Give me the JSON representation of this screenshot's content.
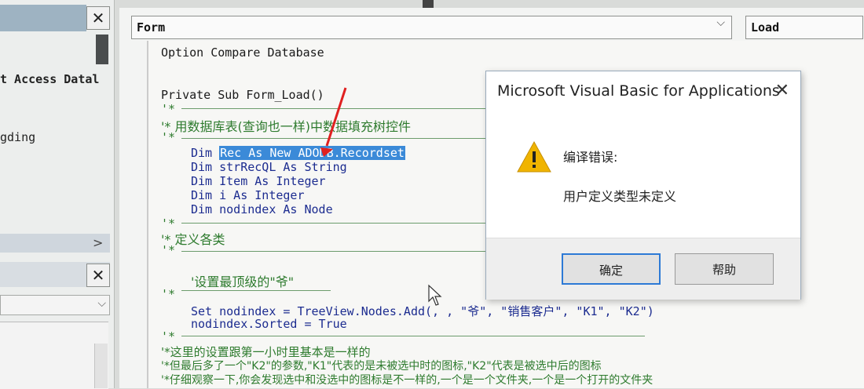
{
  "left_panel": {
    "close_label": "✕",
    "text1": "t Access Datal",
    "text2": "gding",
    "chevron": ">",
    "close2_label": "✕",
    "combo_arrow": "⌵"
  },
  "toolbar": {
    "object_combo": "Form",
    "proc_combo": "Load"
  },
  "code": {
    "line_option": "Option Compare Database",
    "line_sub": "Private Sub Form_Load()",
    "c1a": "'*",
    "c1b": "'* 用数据库表(查询也一样)中数据填充树控件",
    "c1c": "'*",
    "dim1_kw": "Dim ",
    "dim1_sel": "Rec As New ADODB.Recordset",
    "dim2": "Dim strRecQL As String",
    "dim3": "Dim Item As Integer",
    "dim4": "Dim i As Integer",
    "dim5": "Dim nodindex As Node",
    "c2a": "'*",
    "c2b": "'* 定义各类",
    "c2c": "'*",
    "c3": "'设置最顶级的\"爷\"",
    "c3b": "'*",
    "set_line": "Set nodindex = TreeView.Nodes.Add(, , \"爷\", \"销售客户\", \"K1\", \"K2\")",
    "sorted_line": "nodindex.Sorted = True",
    "c4a": "'*",
    "c4b": "'*这里的设置跟第一小时里基本是一样的",
    "c4c": "'*但最后多了一个\"K2\"的参数,\"K1\"代表的是未被选中时的图标,\"K2\"代表是被选中后的图标",
    "c4d": "'*仔细观察一下,你会发现选中和没选中的图标是不一样的,一个是一个文件夹,一个是一个打开的文件夹"
  },
  "dialog": {
    "title": "Microsoft Visual Basic for Applications",
    "close": "✕",
    "message_title": "编译错误:",
    "message_body": "用户定义类型未定义",
    "ok_label": "确定",
    "help_label": "帮助"
  },
  "colors": {
    "selection": "#3b8ad8",
    "comment": "#2e7b2e",
    "keyword": "#1c2c90",
    "annotation_arrow": "#e02020"
  }
}
